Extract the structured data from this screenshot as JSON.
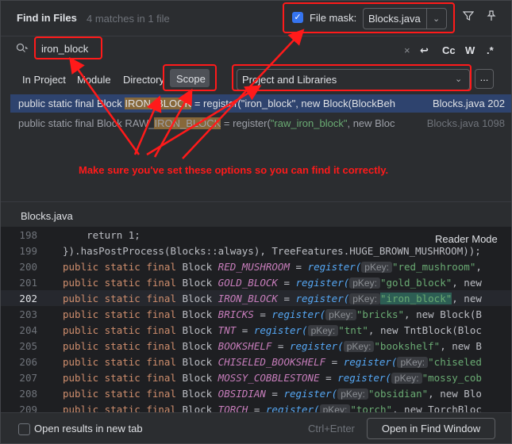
{
  "header": {
    "title": "Find in Files",
    "matches": "4 matches in 1 file",
    "file_mask_label": "File mask:",
    "file_mask_value": "Blocks.java",
    "filter_icon": "funnel-icon",
    "pin_icon": "pin-icon"
  },
  "search": {
    "query": "iron_block",
    "clear_icon": "×",
    "newline_icon": "↩",
    "match_case": "Cc",
    "words": "W",
    "regex": ".*"
  },
  "scope_tabs": [
    "In Project",
    "Module",
    "Directory",
    "Scope"
  ],
  "scope_value": "Project and Libraries",
  "scope_more": "...",
  "results": [
    {
      "pre": "public static final Block ",
      "hl": "IRON_BLOCK",
      "post": " = register(\"iron_block\", new Block(BlockBeh",
      "file": "Blocks.java 202"
    },
    {
      "pre": "public static final Block RAW_",
      "hl": "IRON_BLOCK",
      "post": " = register(",
      "str": "\"raw_iron_block\"",
      "post2": ", new Bloc",
      "file": "Blocks.java 1098"
    }
  ],
  "annotation": "Make sure you've set these options so you can find it correctly.",
  "editor": {
    "file_name": "Blocks.java",
    "reader_mode": "Reader Mode",
    "line_numbers": [
      "198",
      "199",
      "200",
      "201",
      "202",
      "203",
      "204",
      "205",
      "206",
      "207",
      "208",
      "209"
    ],
    "lines": [
      {
        "txt": "    return 1;"
      },
      {
        "txt": "}).hasPostProcess(Blocks::always), TreeFeatures.HUGE_BROWN_MUSHROOM));"
      },
      {
        "name": "RED_MUSHROOM",
        "str": "\"red_mushroom\"",
        "rest": ","
      },
      {
        "name": "GOLD_BLOCK",
        "str": "\"gold_block\"",
        "rest": ", new"
      },
      {
        "name": "IRON_BLOCK",
        "str": "\"iron_block\"",
        "rest": ", new"
      },
      {
        "name": "BRICKS",
        "str": "\"bricks\"",
        "rest": ", new Block(B"
      },
      {
        "name": "TNT",
        "str": "\"tnt\"",
        "rest": ", new TntBlock(Bloc"
      },
      {
        "name": "BOOKSHELF",
        "str": "\"bookshelf\"",
        "rest": ", new B"
      },
      {
        "name": "CHISELED_BOOKSHELF",
        "str": "\"chiseled",
        "rest": ""
      },
      {
        "name": "MOSSY_COBBLESTONE",
        "str": "\"mossy_cob",
        "rest": ""
      },
      {
        "name": "OBSIDIAN",
        "str": "\"obsidian\"",
        "rest": ", new Blo"
      },
      {
        "name": "TORCH",
        "str": "\"torch\"",
        "rest": ", new TorchBloc"
      }
    ],
    "kw": "public static final",
    "type": "Block",
    "assign": "=",
    "register": "register(",
    "hint": "pKey:"
  },
  "footer": {
    "checkbox_label": "Open results in new tab",
    "shortcut": "Ctrl+Enter",
    "open_button": "Open in Find Window"
  },
  "colors": {
    "annotation_red": "#ff1a1a",
    "accent": "#3574f0",
    "highlight": "#87683a"
  }
}
